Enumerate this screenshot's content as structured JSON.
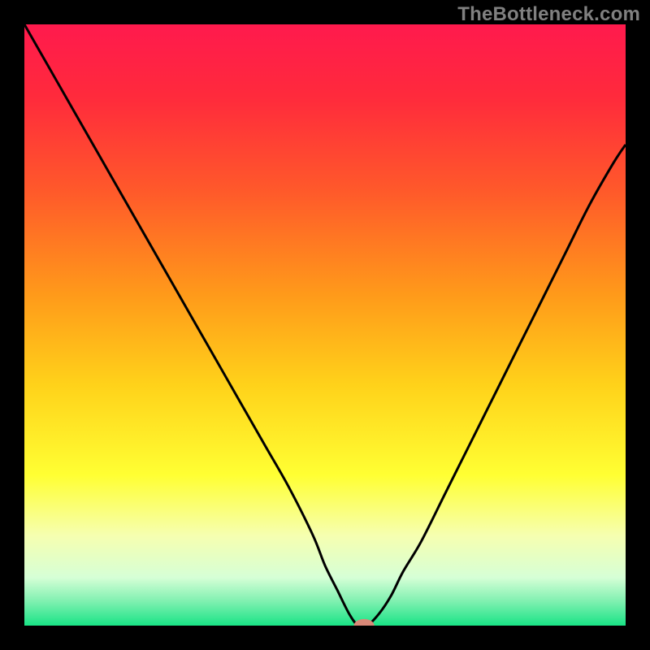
{
  "watermark": "TheBottleneck.com",
  "chart_data": {
    "type": "line",
    "title": "",
    "xlabel": "",
    "ylabel": "",
    "xlim": [
      0,
      100
    ],
    "ylim": [
      0,
      100
    ],
    "grid": false,
    "background": {
      "gradient_stops": [
        {
          "offset": 0.0,
          "color": "#ff1a4d"
        },
        {
          "offset": 0.12,
          "color": "#ff2a3c"
        },
        {
          "offset": 0.28,
          "color": "#ff5a2a"
        },
        {
          "offset": 0.45,
          "color": "#ff9a1a"
        },
        {
          "offset": 0.6,
          "color": "#ffd21a"
        },
        {
          "offset": 0.75,
          "color": "#ffff33"
        },
        {
          "offset": 0.85,
          "color": "#f6ffb0"
        },
        {
          "offset": 0.92,
          "color": "#d6ffd6"
        },
        {
          "offset": 0.96,
          "color": "#7ef0b0"
        },
        {
          "offset": 1.0,
          "color": "#19e386"
        }
      ]
    },
    "series": [
      {
        "name": "bottleneck-curve",
        "color": "#000000",
        "x": [
          0,
          4,
          8,
          12,
          16,
          20,
          24,
          28,
          32,
          36,
          40,
          44,
          48,
          50,
          52,
          54,
          55.5,
          57,
          59,
          61,
          63,
          66,
          70,
          74,
          78,
          82,
          86,
          90,
          94,
          98,
          100
        ],
        "y": [
          100,
          93,
          86,
          79,
          72,
          65,
          58,
          51,
          44,
          37,
          30,
          23,
          15,
          10,
          6,
          2,
          0,
          0,
          2,
          5,
          9,
          14,
          22,
          30,
          38,
          46,
          54,
          62,
          70,
          77,
          80
        ]
      }
    ],
    "marker": {
      "name": "optimal-point",
      "x": 56.5,
      "y": 0,
      "color": "#d98878",
      "rx": 1.7,
      "ry": 1.1
    }
  }
}
